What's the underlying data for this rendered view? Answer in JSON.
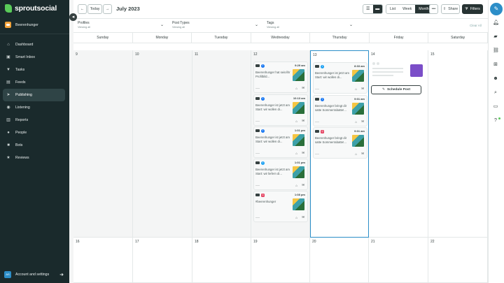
{
  "app": {
    "logo_text": "sproutsocial"
  },
  "sidebar": {
    "profile_name": "Beerenhunger",
    "items": [
      {
        "label": "Dashboard",
        "icon": "home-icon"
      },
      {
        "label": "Smart Inbox",
        "icon": "inbox-icon"
      },
      {
        "label": "Tasks",
        "icon": "pin-icon"
      },
      {
        "label": "Feeds",
        "icon": "feed-icon"
      },
      {
        "label": "Publishing",
        "icon": "paper-plane-icon"
      },
      {
        "label": "Listening",
        "icon": "listening-icon"
      },
      {
        "label": "Reports",
        "icon": "bar-chart-icon"
      },
      {
        "label": "People",
        "icon": "people-icon"
      },
      {
        "label": "Bots",
        "icon": "bot-icon"
      },
      {
        "label": "Reviews",
        "icon": "star-icon"
      }
    ],
    "account": {
      "initials": "AS",
      "label": "Account and settings"
    }
  },
  "toolbar": {
    "today_label": "Today",
    "month_title": "July 2023",
    "views": [
      "List",
      "Week",
      "Month"
    ],
    "selected_view": "Month",
    "share_label": "Share",
    "filters_label": "Filters"
  },
  "filters": {
    "profiles": {
      "label": "Profiles",
      "sub": "Viewing all"
    },
    "post_types": {
      "label": "Post Types",
      "sub": "Viewing all"
    },
    "tags": {
      "label": "Tags",
      "sub": "Viewing all"
    },
    "clear_all": "Clear All"
  },
  "weekdays": [
    "Sunday",
    "Monday",
    "Tuesday",
    "Wednesday",
    "Thursday",
    "Friday",
    "Saturday"
  ],
  "week1": [
    "9",
    "10",
    "11",
    "12",
    "13",
    "14",
    "15"
  ],
  "week2": [
    "16",
    "17",
    "18",
    "19",
    "20",
    "21",
    "22"
  ],
  "schedule_post_label": "Schedule Post",
  "posts": {
    "wed": [
      {
        "network": "facebook",
        "time": "9:29 am",
        "text": "Beerenhunger hat sein/ihr Profilbild..."
      },
      {
        "network": "facebook",
        "time": "10:13 am",
        "text": "Beerenhunger ist jetzt am Start: wir wollen di..."
      },
      {
        "network": "facebook",
        "time": "1:01 pm",
        "text": "Beerenhunger ist jetzt am Start: wir wollen di..."
      },
      {
        "network": "twitter",
        "time": "1:01 pm",
        "text": "Beerenhunger ist jetzt am Start: wir liefern di..."
      },
      {
        "network": "instagram",
        "time": "1:08 pm",
        "text": "#beerenhunger"
      }
    ],
    "thu": [
      {
        "network": "twitter",
        "time": "8:33 am",
        "text": "Beerenhunger ist jetzt am Start: wir wollen di..."
      },
      {
        "network": "facebook",
        "time": "9:01 am",
        "text": "Beerenhunger bringt dir satte Sommerrabatte!..."
      },
      {
        "network": "instagram",
        "time": "9:01 am",
        "text": "Beerenhunger bringt dir satte Sommerrabatte!..."
      }
    ]
  }
}
